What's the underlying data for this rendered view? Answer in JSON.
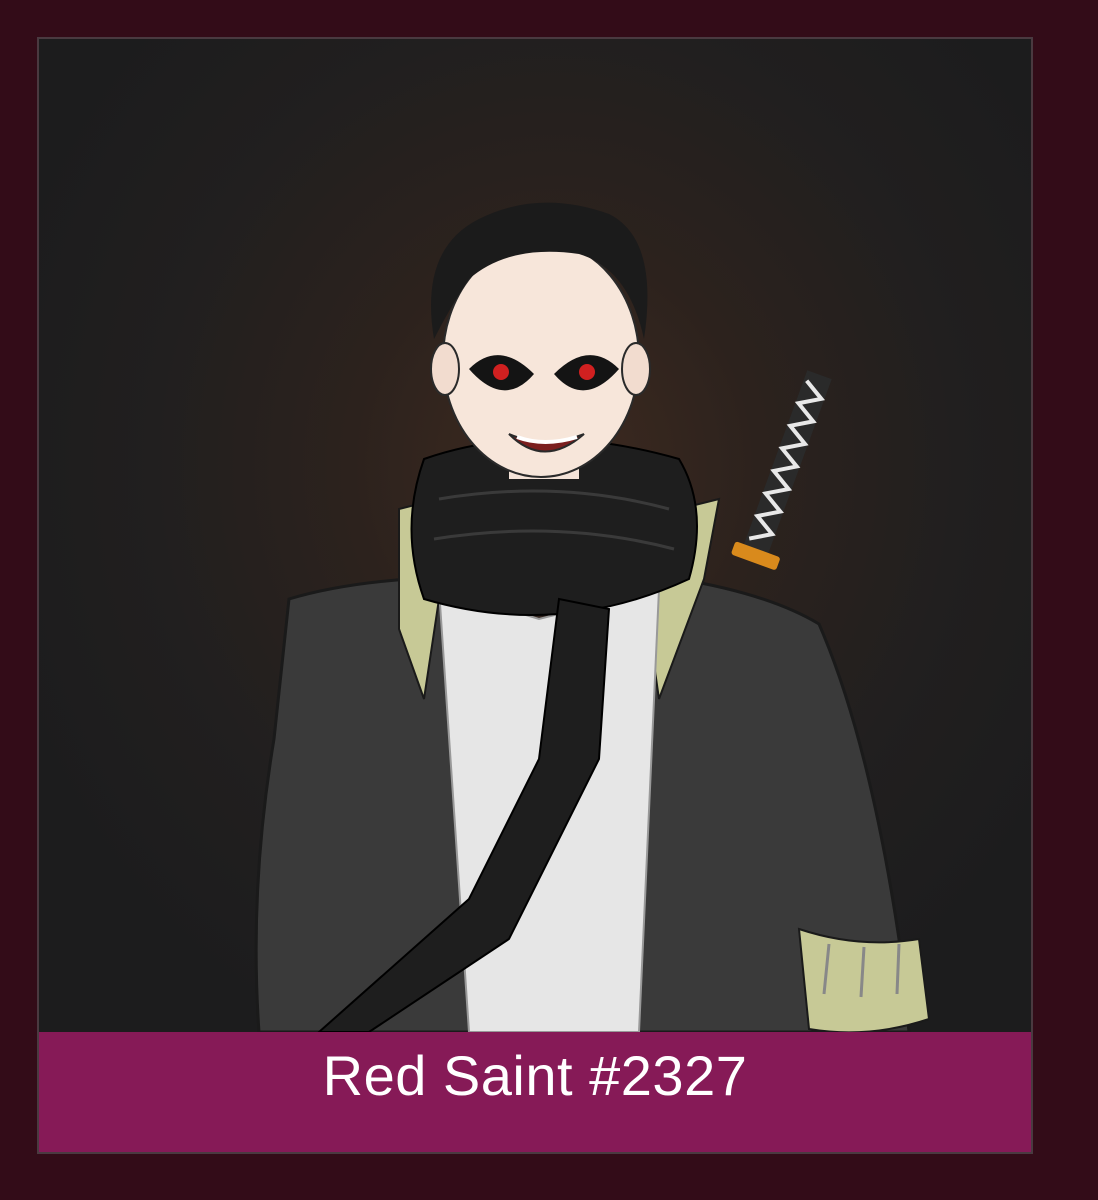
{
  "caption": {
    "title": "Red Saint #2327"
  },
  "colors": {
    "page_background": "#330c18",
    "art_background": "#1d1d1f",
    "caption_bar": "#861a57",
    "caption_text": "#ffffff"
  },
  "artwork": {
    "subject": "anime-style-character-illustration"
  }
}
